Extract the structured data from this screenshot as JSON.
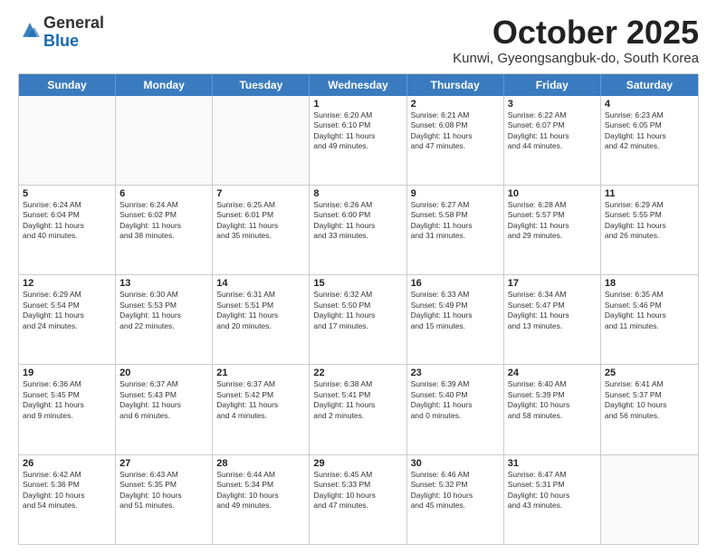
{
  "logo": {
    "general": "General",
    "blue": "Blue"
  },
  "header": {
    "month": "October 2025",
    "location": "Kunwi, Gyeongsangbuk-do, South Korea"
  },
  "days": [
    "Sunday",
    "Monday",
    "Tuesday",
    "Wednesday",
    "Thursday",
    "Friday",
    "Saturday"
  ],
  "rows": [
    [
      {
        "day": "",
        "lines": []
      },
      {
        "day": "",
        "lines": []
      },
      {
        "day": "",
        "lines": []
      },
      {
        "day": "1",
        "lines": [
          "Sunrise: 6:20 AM",
          "Sunset: 6:10 PM",
          "Daylight: 11 hours",
          "and 49 minutes."
        ]
      },
      {
        "day": "2",
        "lines": [
          "Sunrise: 6:21 AM",
          "Sunset: 6:08 PM",
          "Daylight: 11 hours",
          "and 47 minutes."
        ]
      },
      {
        "day": "3",
        "lines": [
          "Sunrise: 6:22 AM",
          "Sunset: 6:07 PM",
          "Daylight: 11 hours",
          "and 44 minutes."
        ]
      },
      {
        "day": "4",
        "lines": [
          "Sunrise: 6:23 AM",
          "Sunset: 6:05 PM",
          "Daylight: 11 hours",
          "and 42 minutes."
        ]
      }
    ],
    [
      {
        "day": "5",
        "lines": [
          "Sunrise: 6:24 AM",
          "Sunset: 6:04 PM",
          "Daylight: 11 hours",
          "and 40 minutes."
        ]
      },
      {
        "day": "6",
        "lines": [
          "Sunrise: 6:24 AM",
          "Sunset: 6:02 PM",
          "Daylight: 11 hours",
          "and 38 minutes."
        ]
      },
      {
        "day": "7",
        "lines": [
          "Sunrise: 6:25 AM",
          "Sunset: 6:01 PM",
          "Daylight: 11 hours",
          "and 35 minutes."
        ]
      },
      {
        "day": "8",
        "lines": [
          "Sunrise: 6:26 AM",
          "Sunset: 6:00 PM",
          "Daylight: 11 hours",
          "and 33 minutes."
        ]
      },
      {
        "day": "9",
        "lines": [
          "Sunrise: 6:27 AM",
          "Sunset: 5:58 PM",
          "Daylight: 11 hours",
          "and 31 minutes."
        ]
      },
      {
        "day": "10",
        "lines": [
          "Sunrise: 6:28 AM",
          "Sunset: 5:57 PM",
          "Daylight: 11 hours",
          "and 29 minutes."
        ]
      },
      {
        "day": "11",
        "lines": [
          "Sunrise: 6:29 AM",
          "Sunset: 5:55 PM",
          "Daylight: 11 hours",
          "and 26 minutes."
        ]
      }
    ],
    [
      {
        "day": "12",
        "lines": [
          "Sunrise: 6:29 AM",
          "Sunset: 5:54 PM",
          "Daylight: 11 hours",
          "and 24 minutes."
        ]
      },
      {
        "day": "13",
        "lines": [
          "Sunrise: 6:30 AM",
          "Sunset: 5:53 PM",
          "Daylight: 11 hours",
          "and 22 minutes."
        ]
      },
      {
        "day": "14",
        "lines": [
          "Sunrise: 6:31 AM",
          "Sunset: 5:51 PM",
          "Daylight: 11 hours",
          "and 20 minutes."
        ]
      },
      {
        "day": "15",
        "lines": [
          "Sunrise: 6:32 AM",
          "Sunset: 5:50 PM",
          "Daylight: 11 hours",
          "and 17 minutes."
        ]
      },
      {
        "day": "16",
        "lines": [
          "Sunrise: 6:33 AM",
          "Sunset: 5:49 PM",
          "Daylight: 11 hours",
          "and 15 minutes."
        ]
      },
      {
        "day": "17",
        "lines": [
          "Sunrise: 6:34 AM",
          "Sunset: 5:47 PM",
          "Daylight: 11 hours",
          "and 13 minutes."
        ]
      },
      {
        "day": "18",
        "lines": [
          "Sunrise: 6:35 AM",
          "Sunset: 5:46 PM",
          "Daylight: 11 hours",
          "and 11 minutes."
        ]
      }
    ],
    [
      {
        "day": "19",
        "lines": [
          "Sunrise: 6:36 AM",
          "Sunset: 5:45 PM",
          "Daylight: 11 hours",
          "and 9 minutes."
        ]
      },
      {
        "day": "20",
        "lines": [
          "Sunrise: 6:37 AM",
          "Sunset: 5:43 PM",
          "Daylight: 11 hours",
          "and 6 minutes."
        ]
      },
      {
        "day": "21",
        "lines": [
          "Sunrise: 6:37 AM",
          "Sunset: 5:42 PM",
          "Daylight: 11 hours",
          "and 4 minutes."
        ]
      },
      {
        "day": "22",
        "lines": [
          "Sunrise: 6:38 AM",
          "Sunset: 5:41 PM",
          "Daylight: 11 hours",
          "and 2 minutes."
        ]
      },
      {
        "day": "23",
        "lines": [
          "Sunrise: 6:39 AM",
          "Sunset: 5:40 PM",
          "Daylight: 11 hours",
          "and 0 minutes."
        ]
      },
      {
        "day": "24",
        "lines": [
          "Sunrise: 6:40 AM",
          "Sunset: 5:39 PM",
          "Daylight: 10 hours",
          "and 58 minutes."
        ]
      },
      {
        "day": "25",
        "lines": [
          "Sunrise: 6:41 AM",
          "Sunset: 5:37 PM",
          "Daylight: 10 hours",
          "and 56 minutes."
        ]
      }
    ],
    [
      {
        "day": "26",
        "lines": [
          "Sunrise: 6:42 AM",
          "Sunset: 5:36 PM",
          "Daylight: 10 hours",
          "and 54 minutes."
        ]
      },
      {
        "day": "27",
        "lines": [
          "Sunrise: 6:43 AM",
          "Sunset: 5:35 PM",
          "Daylight: 10 hours",
          "and 51 minutes."
        ]
      },
      {
        "day": "28",
        "lines": [
          "Sunrise: 6:44 AM",
          "Sunset: 5:34 PM",
          "Daylight: 10 hours",
          "and 49 minutes."
        ]
      },
      {
        "day": "29",
        "lines": [
          "Sunrise: 6:45 AM",
          "Sunset: 5:33 PM",
          "Daylight: 10 hours",
          "and 47 minutes."
        ]
      },
      {
        "day": "30",
        "lines": [
          "Sunrise: 6:46 AM",
          "Sunset: 5:32 PM",
          "Daylight: 10 hours",
          "and 45 minutes."
        ]
      },
      {
        "day": "31",
        "lines": [
          "Sunrise: 6:47 AM",
          "Sunset: 5:31 PM",
          "Daylight: 10 hours",
          "and 43 minutes."
        ]
      },
      {
        "day": "",
        "lines": []
      }
    ]
  ]
}
